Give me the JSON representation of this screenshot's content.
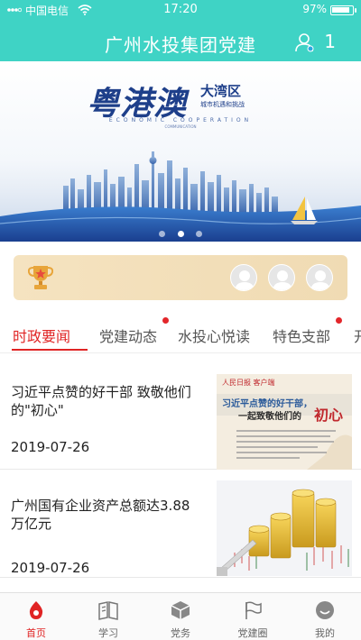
{
  "status_bar": {
    "carrier": "中国电信",
    "time": "17:20",
    "battery": "97%",
    "battery_level": 0.97
  },
  "header": {
    "title": "广州水投集团党建",
    "user_count": "1"
  },
  "banner": {
    "title": "粤港澳",
    "subtitle": "大湾区",
    "subtitle_line2": "城市机遇和挑战",
    "economic_text": "ECONOMIC COOPERATION",
    "communication_text": "COMMUNICATION",
    "slide_count": 3,
    "active_slide": 1
  },
  "tabs": [
    {
      "label": "时政要闻",
      "active": true,
      "badge": false
    },
    {
      "label": "党建动态",
      "active": false,
      "badge": true
    },
    {
      "label": "水投心悦读",
      "active": false,
      "badge": false
    },
    {
      "label": "特色支部",
      "active": false,
      "badge": true
    },
    {
      "label": "开",
      "active": false,
      "badge": false
    }
  ],
  "news": [
    {
      "title": "习近平点赞的好干部 致敬他们的\"初心\"",
      "date": "2019-07-26",
      "thumb_header": "人民日报 客户端",
      "thumb_line1": "习近平点赞的好干部，",
      "thumb_line2": "一起致敬他们的",
      "thumb_word": "初心"
    },
    {
      "title": "广州国有企业资产总额达3.88万亿元",
      "date": "2019-07-26"
    }
  ],
  "bottom_nav": [
    {
      "label": "首页",
      "icon": "home-icon",
      "active": true
    },
    {
      "label": "学习",
      "icon": "book-icon",
      "active": false
    },
    {
      "label": "党务",
      "icon": "cube-icon",
      "active": false
    },
    {
      "label": "党建圈",
      "icon": "flag-icon",
      "active": false
    },
    {
      "label": "我的",
      "icon": "smile-icon",
      "active": false
    }
  ],
  "colors": {
    "primary": "#3fd3c5",
    "accent_red": "#e02424",
    "card_gold": "#f0dbb3"
  }
}
